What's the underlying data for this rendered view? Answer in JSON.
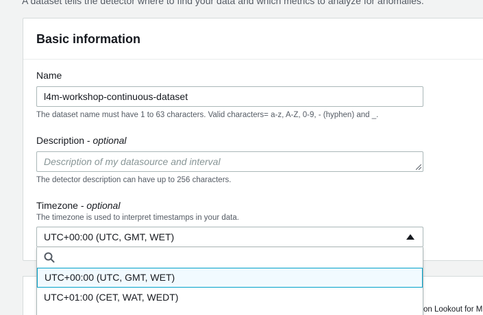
{
  "intro_text": "A dataset tells the detector where to find your data and which metrics to analyze for anomalies.",
  "panel": {
    "title": "Basic information"
  },
  "name_field": {
    "label": "Name",
    "value": "l4m-workshop-continuous-dataset",
    "hint": "The dataset name must have 1 to 63 characters. Valid characters= a-z, A-Z, 0-9, - (hyphen) and _."
  },
  "description_field": {
    "label": "Description -",
    "optional": "optional",
    "placeholder": "Description of my datasource and interval",
    "hint": "The detector description can have up to 256 characters."
  },
  "timezone_field": {
    "label": "Timezone -",
    "optional": "optional",
    "hint": "The timezone is used to interpret timestamps in your data.",
    "selected_value": "UTC+00:00 (UTC, GMT, WET)",
    "options": [
      "UTC+00:00 (UTC, GMT, WET)",
      "UTC+01:00 (CET, WAT, WEDT)"
    ]
  },
  "side_text": "on Lookout for M",
  "icons": {
    "search": "search-icon",
    "caret": "caret-up-icon",
    "resize": "resize-grip-icon"
  },
  "colors": {
    "accent": "#00a1c9",
    "selected_bg": "#f1faff"
  }
}
